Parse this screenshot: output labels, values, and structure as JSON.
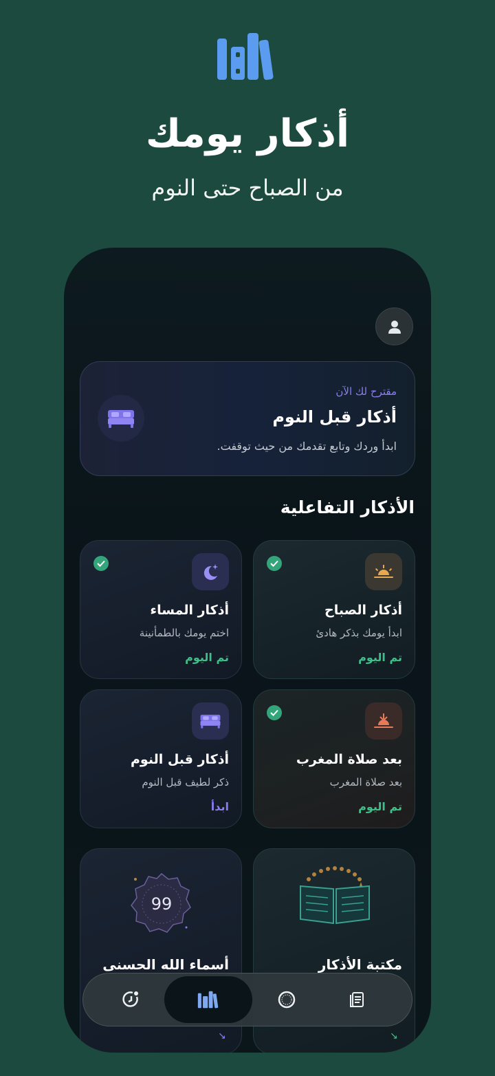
{
  "promo": {
    "title": "أذكار يومك",
    "subtitle": "من الصباح حتى النوم",
    "logo_icon": "library-books-icon",
    "logo_color": "#5b9cf0"
  },
  "header": {
    "profile_icon": "user-icon"
  },
  "suggestion": {
    "eyebrow": "مقترح لك الآن",
    "title": "أذكار قبل النوم",
    "description": "ابدأ وردك وتابع تقدمك من حيث توقفت.",
    "icon": "bed-icon"
  },
  "section": {
    "title": "الأذكار التفاعلية"
  },
  "tiles": [
    {
      "title": "أذكار الصباح",
      "description": "ابدأ يومك بذكر هادئ",
      "status": "تم اليوم",
      "completed": true,
      "icon": "sunrise-icon"
    },
    {
      "title": "أذكار المساء",
      "description": "اختم يومك بالطمأنينة",
      "status": "تم اليوم",
      "completed": true,
      "icon": "moon-stars-icon"
    },
    {
      "title": "بعد صلاة المغرب",
      "description": "بعد صلاة المغرب",
      "status": "تم اليوم",
      "completed": true,
      "icon": "sunset-icon"
    },
    {
      "title": "أذكار قبل النوم",
      "description": "ذكر لطيف قبل النوم",
      "status": "ابدأ",
      "completed": false,
      "icon": "bed-icon"
    }
  ],
  "big_tiles": [
    {
      "title": "مكتبة الأذكار",
      "icon": "open-book-prayer-beads-icon"
    },
    {
      "title": "أسماء الله الحسنى",
      "badge": "99",
      "icon": "ornament-badge-icon"
    }
  ],
  "nav": [
    {
      "name": "library",
      "icon": "library-books-icon",
      "active": true
    },
    {
      "name": "stats",
      "icon": "clock-chart-icon",
      "active": false
    },
    {
      "name": "tasbih",
      "icon": "ring-icon",
      "active": false
    },
    {
      "name": "quran",
      "icon": "book-pages-icon",
      "active": false
    }
  ],
  "colors": {
    "background": "#1d4a3e",
    "accent_green": "#3fbf8a",
    "accent_purple": "#8b7df0",
    "accent_blue": "#5b9cf0"
  }
}
